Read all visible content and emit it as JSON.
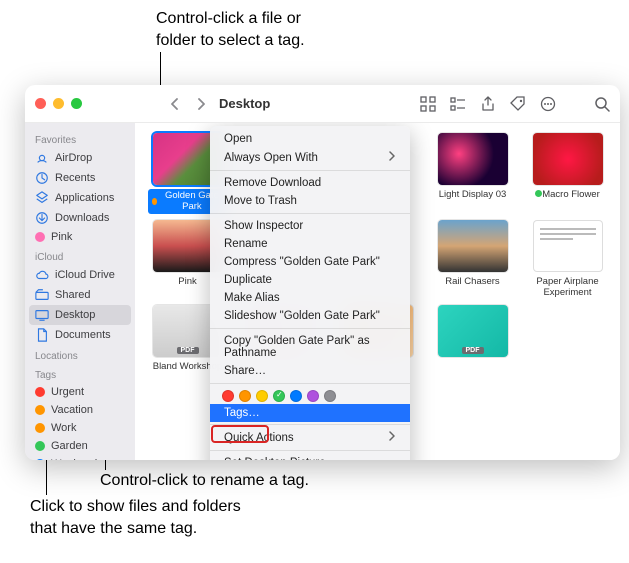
{
  "annotations": {
    "top": "Control-click a file or\nfolder to select a tag.",
    "mid": "Control-click to rename a tag.",
    "bottom": "Click to show files and folders\nthat have the same tag."
  },
  "window": {
    "title": "Desktop"
  },
  "sidebar": {
    "sections": [
      {
        "title": "Favorites",
        "items": [
          {
            "icon": "airdrop",
            "label": "AirDrop"
          },
          {
            "icon": "clock",
            "label": "Recents"
          },
          {
            "icon": "app",
            "label": "Applications"
          },
          {
            "icon": "download",
            "label": "Downloads"
          },
          {
            "icon": "tag",
            "label": "Pink",
            "tagColor": "#ff6fb3"
          }
        ]
      },
      {
        "title": "iCloud",
        "items": [
          {
            "icon": "cloud",
            "label": "iCloud Drive"
          },
          {
            "icon": "shared",
            "label": "Shared"
          },
          {
            "icon": "desktop",
            "label": "Desktop",
            "selected": true
          },
          {
            "icon": "doc",
            "label": "Documents"
          }
        ]
      },
      {
        "title": "Locations",
        "items": []
      },
      {
        "title": "Tags",
        "items": [
          {
            "tagColor": "#ff3b30",
            "label": "Urgent"
          },
          {
            "tagColor": "#ff9500",
            "label": "Vacation"
          },
          {
            "tagColor": "#ff9500",
            "label": "Work"
          },
          {
            "tagColor": "#34c759",
            "label": "Garden"
          },
          {
            "tagColor": "#007aff",
            "label": "Weekend"
          }
        ]
      }
    ]
  },
  "files": [
    {
      "label": "Golden Gate Park",
      "selected": true,
      "thumb": {
        "style": "photo-flowers"
      }
    },
    {
      "label": "",
      "hidden_by_menu": true
    },
    {
      "label": "",
      "hidden_by_menu": true
    },
    {
      "label": "Light Display 03",
      "thumb": {
        "style": "photo-lights"
      }
    },
    {
      "label": "Macro Flower",
      "tagColor": "#34c759",
      "thumb": {
        "style": "photo-red"
      }
    },
    {
      "label": "Pink",
      "thumb": {
        "style": "photo-portrait"
      }
    },
    {
      "label": "",
      "hidden_by_menu": true
    },
    {
      "label": "",
      "hidden_by_menu": true
    },
    {
      "label": "Rail Chasers",
      "thumb": {
        "style": "photo-rail"
      }
    },
    {
      "label": "Paper Airplane Experiment",
      "thumb": {
        "style": "doc-sheet"
      }
    },
    {
      "label": "Bland Workshop",
      "thumb": {
        "style": "pdf-bland"
      },
      "pdf": true
    },
    {
      "label": "",
      "thumb": {
        "style": "pdf-generic"
      },
      "pdf": true
    },
    {
      "label": "",
      "thumb": {
        "style": "pdf-generic2"
      },
      "pdf": true
    },
    {
      "label": "",
      "thumb": {
        "style": "pdf-marketing"
      },
      "pdf": true
    },
    {
      "label": "",
      "empty": true
    }
  ],
  "context_menu": {
    "groups": [
      [
        {
          "label": "Open"
        },
        {
          "label": "Always Open With",
          "submenu": true
        }
      ],
      [
        {
          "label": "Remove Download"
        },
        {
          "label": "Move to Trash"
        }
      ],
      [
        {
          "label": "Show Inspector"
        },
        {
          "label": "Rename"
        },
        {
          "label": "Compress \"Golden Gate Park\""
        },
        {
          "label": "Duplicate"
        },
        {
          "label": "Make Alias"
        },
        {
          "label": "Slideshow \"Golden Gate Park\""
        }
      ],
      [
        {
          "label": "Copy \"Golden Gate Park\" as Pathname"
        },
        {
          "label": "Share…"
        }
      ],
      [
        {
          "type": "tags",
          "colors": [
            "#ff3b30",
            "#ff9500",
            "#ffcc00",
            "#34c759",
            "#007aff",
            "#af52de",
            "#8e8e93"
          ],
          "selectedIndex": 3
        },
        {
          "label": "Tags…",
          "highlighted": true
        }
      ],
      [
        {
          "label": "Quick Actions",
          "submenu": true
        }
      ],
      [
        {
          "label": "Set Desktop Picture"
        }
      ]
    ]
  }
}
